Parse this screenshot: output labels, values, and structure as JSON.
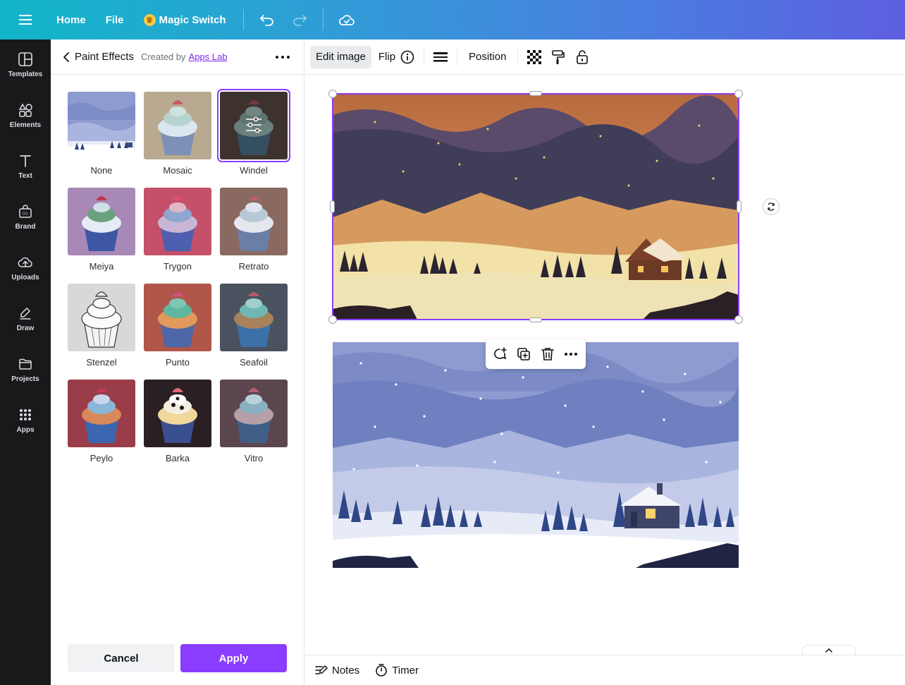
{
  "topbar": {
    "home_label": "Home",
    "file_label": "File",
    "magic_switch_label": "Magic Switch"
  },
  "rail": {
    "items": [
      {
        "label": "Templates"
      },
      {
        "label": "Elements"
      },
      {
        "label": "Text"
      },
      {
        "label": "Brand"
      },
      {
        "label": "Uploads"
      },
      {
        "label": "Draw"
      },
      {
        "label": "Projects"
      },
      {
        "label": "Apps"
      }
    ]
  },
  "panel": {
    "title": "Paint Effects",
    "created_by": "Created by",
    "author": "Apps Lab",
    "selected_effect": "Windel",
    "effects": [
      {
        "name": "None"
      },
      {
        "name": "Mosaic"
      },
      {
        "name": "Windel"
      },
      {
        "name": "Meiya"
      },
      {
        "name": "Trygon"
      },
      {
        "name": "Retrato"
      },
      {
        "name": "Stenzel"
      },
      {
        "name": "Punto"
      },
      {
        "name": "Seafoil"
      },
      {
        "name": "Peylo"
      },
      {
        "name": "Barka"
      },
      {
        "name": "Vitro"
      }
    ],
    "cancel_label": "Cancel",
    "apply_label": "Apply"
  },
  "context_toolbar": {
    "edit_image_label": "Edit image",
    "flip_label": "Flip",
    "position_label": "Position"
  },
  "footer": {
    "notes_label": "Notes",
    "timer_label": "Timer"
  },
  "colors": {
    "accent": "#8b3dff",
    "rail_bg": "#18191b"
  }
}
